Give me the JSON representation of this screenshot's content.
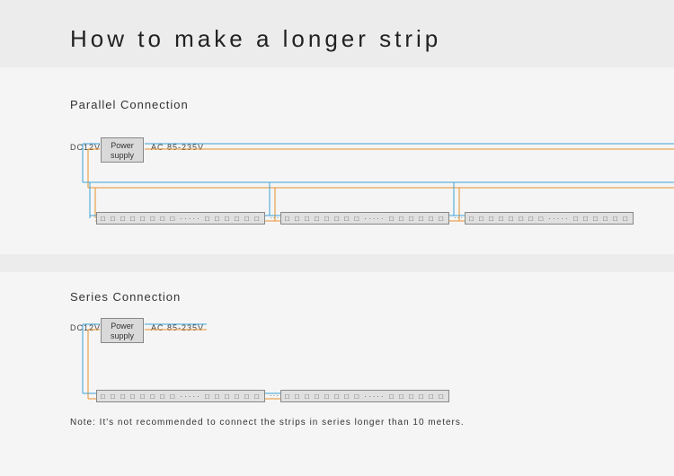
{
  "title": "How to make a longer strip",
  "sections": {
    "parallel": {
      "label": "Parallel Connection"
    },
    "series": {
      "label": "Series Connection"
    }
  },
  "labels": {
    "dc": "DC12V",
    "ac": "AC 85-235V",
    "power": "Power supply"
  },
  "strip_pattern": "□ □ □ □ □ □ □ □ □  ·····  □ □ □ □ □ □ □",
  "note": "Note: It's not recommended to connect the strips in series longer than 10 meters.",
  "colors": {
    "blue_wire": "#3aa3d8",
    "orange_wire": "#e8912a"
  }
}
